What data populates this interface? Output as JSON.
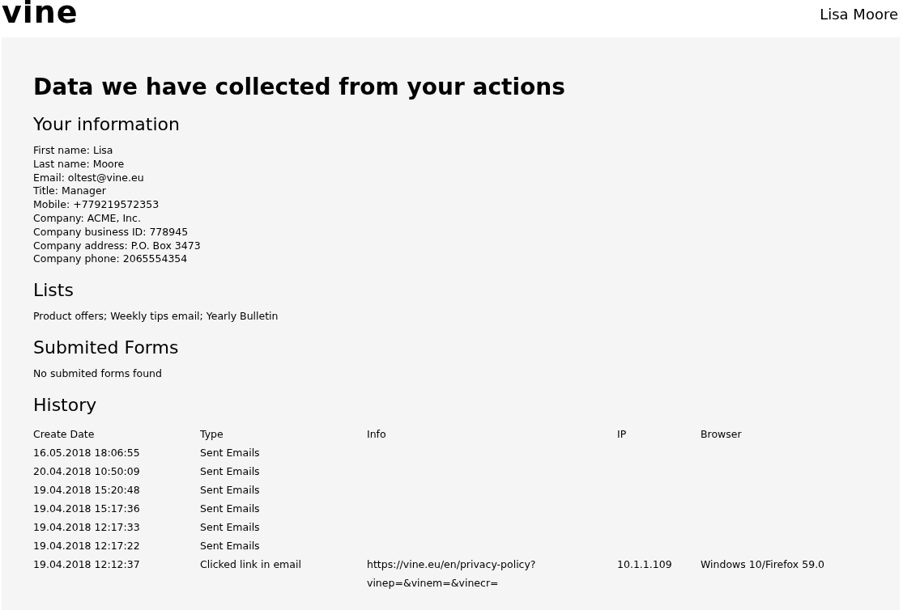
{
  "header": {
    "logo": "vine",
    "user_name": "Lisa Moore"
  },
  "title": "Data we have collected from your actions",
  "sections": [
    {
      "kind": "lines",
      "heading": "Your information",
      "lines": [
        "First name: Lisa",
        "Last name: Moore",
        "Email: oltest@vine.eu",
        "Title: Manager",
        "Mobile: +779219572353",
        "Company: ACME, Inc.",
        "Company business ID: 778945",
        "Company address: P.O. Box 3473",
        "Company phone: 2065554354"
      ]
    },
    {
      "kind": "lines",
      "heading": "Lists",
      "lines": [
        "Product offers; Weekly tips email; Yearly Bulletin"
      ]
    },
    {
      "kind": "lines",
      "heading": "Submited Forms",
      "lines": [
        "No submited forms found"
      ]
    },
    {
      "kind": "table",
      "heading": "History",
      "columns": [
        "Create Date",
        "Type",
        "Info",
        "IP",
        "Browser"
      ],
      "rows": [
        [
          "16.05.2018 18:06:55",
          "Sent Emails",
          "",
          "",
          ""
        ],
        [
          "20.04.2018 10:50:09",
          "Sent Emails",
          "",
          "",
          ""
        ],
        [
          "19.04.2018 15:20:48",
          "Sent Emails",
          "",
          "",
          ""
        ],
        [
          "19.04.2018 15:17:36",
          "Sent Emails",
          "",
          "",
          ""
        ],
        [
          "19.04.2018 12:17:33",
          "Sent Emails",
          "",
          "",
          ""
        ],
        [
          "19.04.2018 12:17:22",
          "Sent Emails",
          "",
          "",
          ""
        ],
        [
          "19.04.2018 12:12:37",
          "Clicked link in email",
          "https://vine.eu/en/privacy-policy?vinep=&vinem=&vinecr=",
          "10.1.1.109",
          "Windows 10/Firefox 59.0"
        ]
      ]
    }
  ]
}
